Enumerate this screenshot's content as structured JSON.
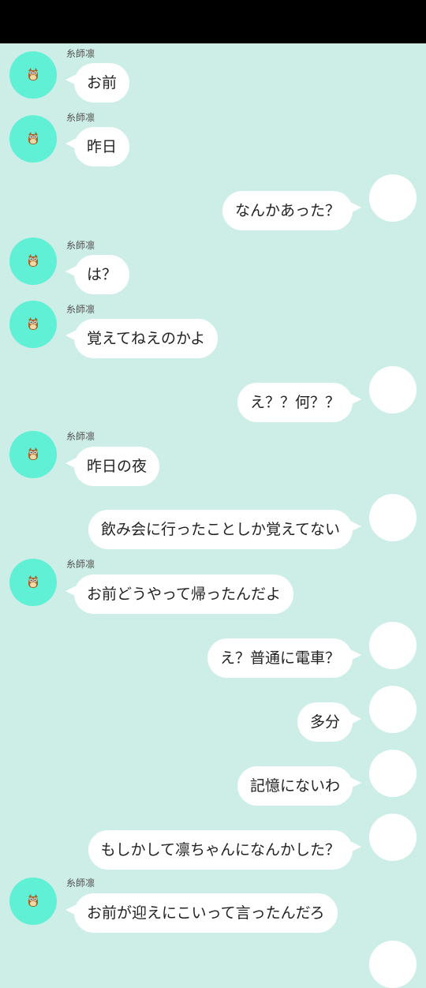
{
  "colors": {
    "background": "#cdeee6",
    "status_bar": "#000000",
    "bubble": "#ffffff",
    "sender_avatar": "#5ff0d6",
    "self_avatar": "#ffffff"
  },
  "contact": {
    "name": "糸師凛",
    "avatar_icon": "owl-icon"
  },
  "messages": [
    {
      "from": "them",
      "name": "糸師凛",
      "text": "お前"
    },
    {
      "from": "them",
      "name": "糸師凛",
      "text": "昨日"
    },
    {
      "from": "me",
      "text": "なんかあった？"
    },
    {
      "from": "them",
      "name": "糸師凛",
      "text": "は？"
    },
    {
      "from": "them",
      "name": "糸師凛",
      "text": "覚えてねえのかよ"
    },
    {
      "from": "me",
      "text": "え？？何？？"
    },
    {
      "from": "them",
      "name": "糸師凛",
      "text": "昨日の夜"
    },
    {
      "from": "me",
      "text": "飲み会に行ったことしか覚えてない"
    },
    {
      "from": "them",
      "name": "糸師凛",
      "text": "お前どうやって帰ったんだよ"
    },
    {
      "from": "me",
      "text": "え？普通に電車？"
    },
    {
      "from": "me",
      "text": "多分"
    },
    {
      "from": "me",
      "text": "記憶にないわ"
    },
    {
      "from": "me",
      "text": "もしかして凛ちゃんになんかした？"
    },
    {
      "from": "them",
      "name": "糸師凛",
      "text": "お前が迎えにこいって言ったんだろ"
    }
  ]
}
